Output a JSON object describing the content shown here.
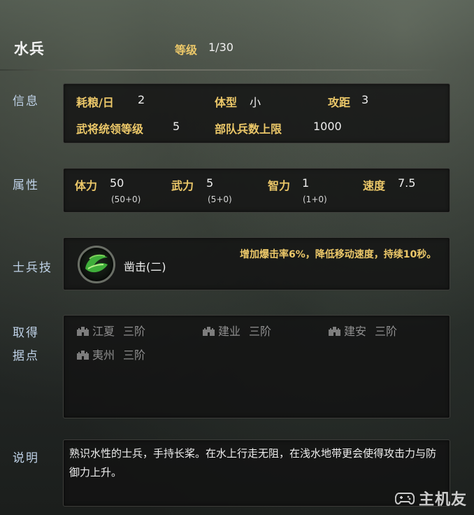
{
  "header": {
    "unit_name": "水兵",
    "level_label": "等级",
    "level_value": "1/30"
  },
  "info": {
    "label": "信息",
    "grain_label": "耗粮/日",
    "grain_value": "2",
    "size_label": "体型",
    "size_value": "小",
    "range_label": "攻距",
    "range_value": "3",
    "general_level_label": "武将统领等级",
    "general_level_value": "5",
    "troop_limit_label": "部队兵数上限",
    "troop_limit_value": "1000"
  },
  "attributes": {
    "label": "属性",
    "stamina_label": "体力",
    "stamina_value": "50",
    "stamina_detail": "(50+0)",
    "force_label": "武力",
    "force_value": "5",
    "force_detail": "(5+0)",
    "intellect_label": "智力",
    "intellect_value": "1",
    "intellect_detail": "(1+0)",
    "speed_label": "速度",
    "speed_value": "7.5"
  },
  "skill": {
    "label": "士兵技",
    "icon": "green-leaf-swirl-icon",
    "name": "凿击(二)",
    "description": "增加爆击率6%，降低移动速度，持续10秒。"
  },
  "bases": {
    "label_line1": "取得",
    "label_line2": "据点",
    "icon": "castle-icon",
    "items": [
      {
        "name": "江夏",
        "tier": "三阶"
      },
      {
        "name": "建业",
        "tier": "三阶"
      },
      {
        "name": "建安",
        "tier": "三阶"
      },
      {
        "name": "夷州",
        "tier": "三阶"
      }
    ]
  },
  "description": {
    "label": "说明",
    "text": "熟识水性的士兵，手持长桨。在水上行走无阻，在浅水地带更会使得攻击力与防御力上升。"
  },
  "watermark": {
    "text": "主机友",
    "icon": "gamepad-icon"
  },
  "colors": {
    "key": "#ecc869",
    "label": "#bfd2e8",
    "value": "#eeeeee",
    "muted": "#8f8f8f"
  }
}
